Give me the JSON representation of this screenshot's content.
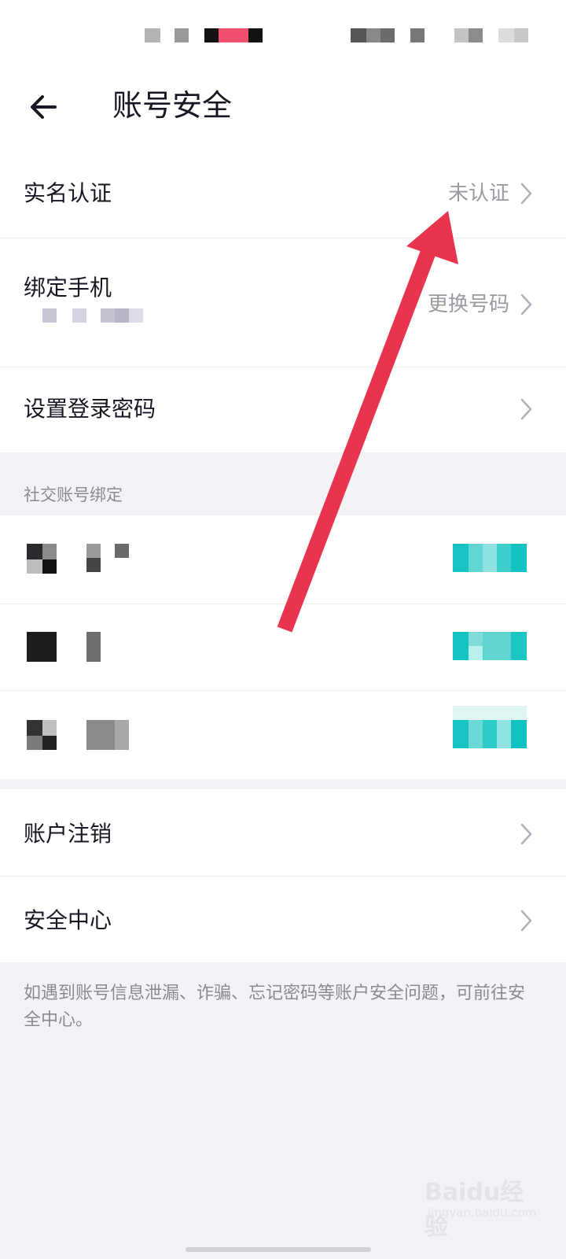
{
  "header": {
    "title": "账号安全",
    "back_icon": "arrow-left-icon"
  },
  "account_rows": [
    {
      "label": "实名认证",
      "value": "未认证"
    },
    {
      "label": "绑定手机",
      "value": "更换号码"
    },
    {
      "label": "设置登录密码",
      "value": ""
    }
  ],
  "social": {
    "section_title": "社交账号绑定"
  },
  "bottom_rows": [
    {
      "label": "账户注销"
    },
    {
      "label": "安全中心"
    }
  ],
  "footer_note": "如遇到账号信息泄漏、诈骗、忘记密码等账户安全问题，可前往安全中心。",
  "watermark": {
    "text": "Baidu经验",
    "sub": "jingyan.baidu.com"
  },
  "colors": {
    "background": "#f2f2f7",
    "text_primary": "#161823",
    "text_secondary": "#9a9aa2",
    "annotation_arrow": "#e8344e",
    "social_status": "#1ec8c8"
  }
}
